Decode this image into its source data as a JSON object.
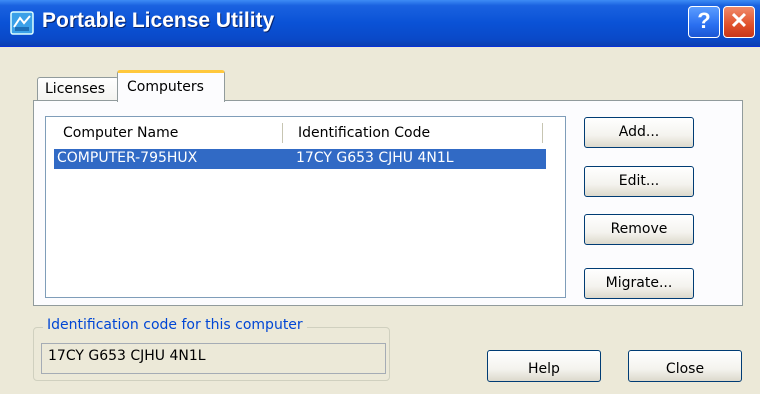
{
  "window": {
    "title": "Portable License Utility",
    "title_buttons": {
      "help": "?",
      "close": "✕"
    }
  },
  "tabs": [
    {
      "label": "Licenses",
      "selected": false
    },
    {
      "label": "Computers",
      "selected": true
    }
  ],
  "computer_list": {
    "columns": [
      "Computer Name",
      "Identification Code"
    ],
    "rows": [
      {
        "name": "COMPUTER-795HUX",
        "code": "17CY G653 CJHU 4N1L",
        "selected": true
      }
    ]
  },
  "actions": {
    "add": "Add...",
    "edit": "Edit...",
    "remove": "Remove",
    "migrate": "Migrate..."
  },
  "identification": {
    "legend": "Identification code for this computer",
    "value": "17CY G653 CJHU 4N1L"
  },
  "footer": {
    "help": "Help",
    "close": "Close"
  },
  "colors": {
    "titlebar": "#0a52d6",
    "selection": "#316ac5",
    "legend_text": "#0046d5",
    "tab_highlight": "#ffc83c",
    "window_bg": "#ece9d8"
  }
}
